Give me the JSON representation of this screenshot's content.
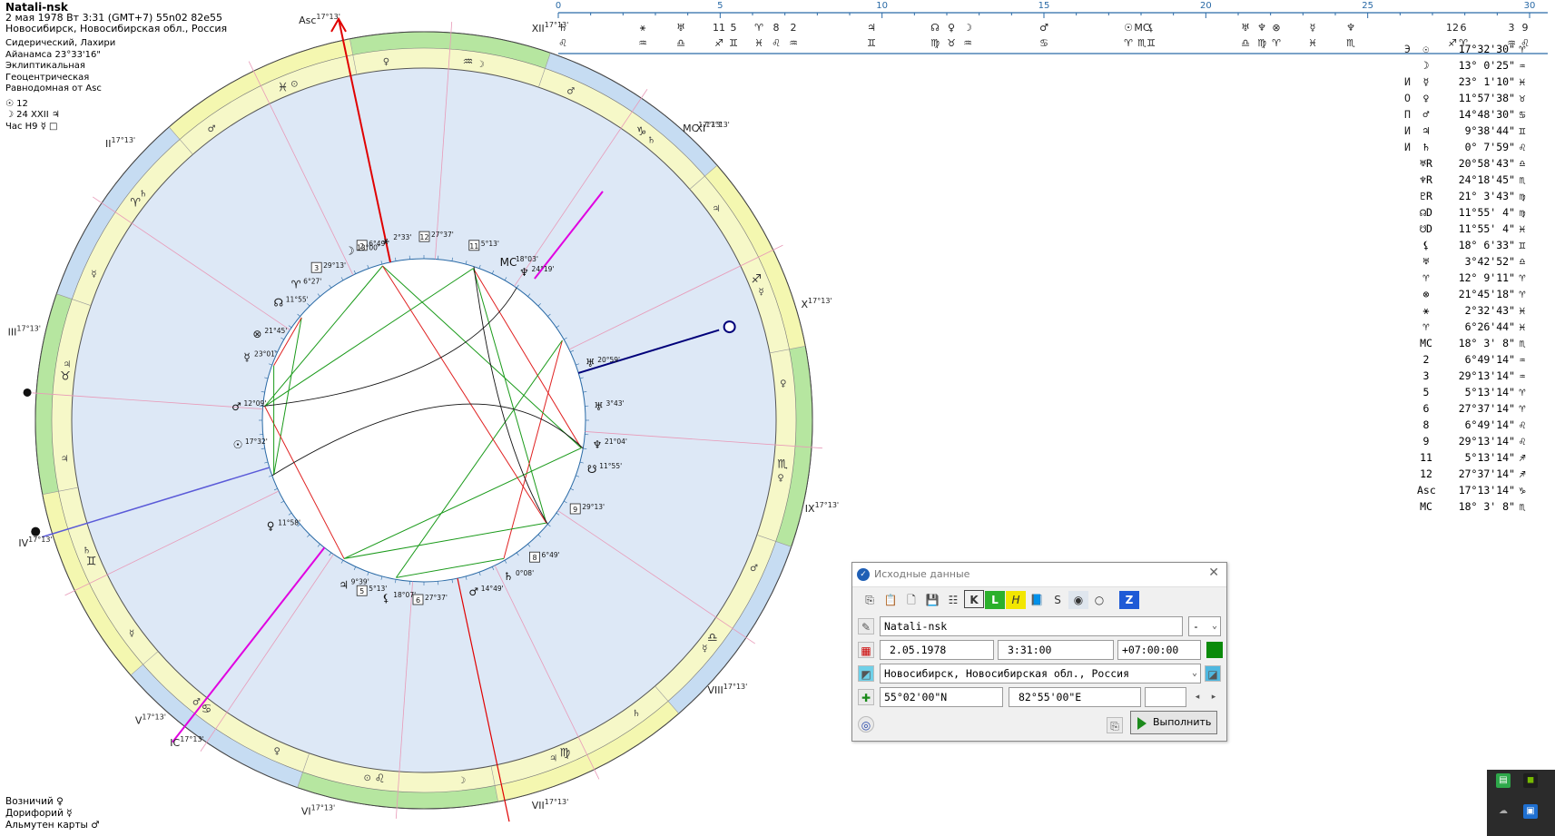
{
  "chart": {
    "name": "Natali-nsk",
    "datetime": "2 мая 1978  Вт   3:31 (GMT+7) 55n02  82e55",
    "place": "Новосибирск, Новосибирская обл., Россия",
    "settings": [
      "Сидерический, Лахири",
      "Айанамса 23°33'16\"",
      "Эклиптикальная",
      "Геоцентрическая",
      "Равнодомная от Asc"
    ],
    "extra": [
      "☉  12",
      "☽  24 XXII ♃",
      "Час Н9 ☿ □"
    ]
  },
  "bottom_left": [
    "Возничий  ♀",
    "Дорифорий  ☿",
    "Альмутен карты  ♂"
  ],
  "wheel": {
    "houses": [
      {
        "num": "XII",
        "deg": "17°13'"
      },
      {
        "num": "XI",
        "deg": "17°13'"
      },
      {
        "num": "X",
        "deg": "17°13'"
      },
      {
        "num": "IX",
        "deg": "17°13'"
      },
      {
        "num": "VIII",
        "deg": "17°13'"
      },
      {
        "num": "VII",
        "deg": "17°13'"
      },
      {
        "num": "VI",
        "deg": "17°13'"
      },
      {
        "num": "V",
        "deg": "17°13'"
      },
      {
        "num": "IV",
        "deg": "17°13'"
      },
      {
        "num": "III",
        "deg": "17°13'"
      },
      {
        "num": "II",
        "deg": "17°13'"
      }
    ],
    "asc_label": "Asc",
    "asc_deg": "17°13'",
    "mc_label": "MC",
    "mc_deg": "17°13'",
    "ic_label": "IC",
    "ic_deg": "17°13'",
    "signs": [
      "♉",
      "♊",
      "♋",
      "♌",
      "♍",
      "♎",
      "♏",
      "♐",
      "♑",
      "♒",
      "♓",
      "♈"
    ],
    "inner_labels": [
      {
        "t": "12",
        "box": true,
        "d": "27°37'"
      },
      {
        "t": "11",
        "box": true,
        "d": "5°13'"
      },
      {
        "t": "2",
        "box": true,
        "d": "6°49'"
      },
      {
        "t": "⚹",
        "box": false,
        "d": "2°33'"
      },
      {
        "t": "☽",
        "box": false,
        "d": "13°00'"
      },
      {
        "t": "3",
        "box": true,
        "d": "29°13'"
      },
      {
        "t": "♈",
        "box": false,
        "d": "6°27'"
      },
      {
        "t": "☊",
        "box": false,
        "d": "11°55'"
      },
      {
        "t": "⊗",
        "box": false,
        "d": "21°45'"
      },
      {
        "t": "☿",
        "box": false,
        "d": "23°01'"
      },
      {
        "t": "♂",
        "box": false,
        "d": "12°09'"
      },
      {
        "t": "☉",
        "box": false,
        "d": "17°32'"
      },
      {
        "t": "♀",
        "box": false,
        "d": "11°58'"
      },
      {
        "t": "♃",
        "box": false,
        "d": "9°39'"
      },
      {
        "t": "5",
        "box": true,
        "d": "5°13'"
      },
      {
        "t": "⚸",
        "box": false,
        "d": "18°07'"
      },
      {
        "t": "6",
        "box": true,
        "d": "27°37'"
      },
      {
        "t": "♂",
        "box": false,
        "d": "14°49'"
      },
      {
        "t": "♄",
        "box": false,
        "d": "0°08'"
      },
      {
        "t": "8",
        "box": true,
        "d": "6°49'"
      },
      {
        "t": "9",
        "box": true,
        "d": "29°13'"
      },
      {
        "t": "☋",
        "box": false,
        "d": "11°55'"
      },
      {
        "t": "♆",
        "box": false,
        "d": "21°04'"
      },
      {
        "t": "♅",
        "box": false,
        "d": "3°43'"
      },
      {
        "t": "♅",
        "box": false,
        "d": "20°59'"
      },
      {
        "t": "♆",
        "box": false,
        "d": "24°19'"
      },
      {
        "t": "MC",
        "box": false,
        "d": "18°03'"
      }
    ]
  },
  "timeline": {
    "ticks": [
      "0",
      "5",
      "10",
      "15",
      "20",
      "25",
      "30"
    ]
  },
  "positions": [
    {
      "p": "Э",
      "g": "☉",
      "v": "17°32'30\"",
      "s": "♈"
    },
    {
      "p": "",
      "g": "☽",
      "v": "13° 0'25\"",
      "s": "♒"
    },
    {
      "p": "И",
      "g": "☿",
      "v": "23° 1'10\"",
      "s": "♓"
    },
    {
      "p": "О",
      "g": "♀",
      "v": "11°57'38\"",
      "s": "♉"
    },
    {
      "p": "П",
      "g": "♂",
      "v": "14°48'30\"",
      "s": "♋"
    },
    {
      "p": "И",
      "g": "♃",
      "v": "9°38'44\"",
      "s": "♊"
    },
    {
      "p": "И",
      "g": "♄",
      "v": "0° 7'59\"",
      "s": "♌"
    },
    {
      "p": "",
      "g": "♅R",
      "v": "20°58'43\"",
      "s": "♎"
    },
    {
      "p": "",
      "g": "♆R",
      "v": "24°18'45\"",
      "s": "♏"
    },
    {
      "p": "",
      "g": "♇R",
      "v": "21° 3'43\"",
      "s": "♍"
    },
    {
      "p": "",
      "g": "☊D",
      "v": "11°55' 4\"",
      "s": "♍"
    },
    {
      "p": "",
      "g": "☋D",
      "v": "11°55' 4\"",
      "s": "♓"
    },
    {
      "p": "",
      "g": "⚸",
      "v": "18° 6'33\"",
      "s": "♊"
    },
    {
      "p": "",
      "g": "♅",
      "v": "3°42'52\"",
      "s": "♎"
    },
    {
      "p": "",
      "g": "♈",
      "v": "12° 9'11\"",
      "s": "♈"
    },
    {
      "p": "",
      "g": "⊗",
      "v": "21°45'18\"",
      "s": "♈"
    },
    {
      "p": "",
      "g": "⚹",
      "v": "2°32'43\"",
      "s": "♓"
    },
    {
      "p": "",
      "g": "♈",
      "v": "6°26'44\"",
      "s": "♓"
    },
    {
      "p": "",
      "g": "MC",
      "v": "18° 3' 8\"",
      "s": "♏"
    },
    {
      "p": "",
      "g": "2",
      "v": "6°49'14\"",
      "s": "♒"
    },
    {
      "p": "",
      "g": "3",
      "v": "29°13'14\"",
      "s": "♒"
    },
    {
      "p": "",
      "g": "5",
      "v": "5°13'14\"",
      "s": "♈"
    },
    {
      "p": "",
      "g": "6",
      "v": "27°37'14\"",
      "s": "♈"
    },
    {
      "p": "",
      "g": "8",
      "v": "6°49'14\"",
      "s": "♌"
    },
    {
      "p": "",
      "g": "9",
      "v": "29°13'14\"",
      "s": "♌"
    },
    {
      "p": "",
      "g": "11",
      "v": "5°13'14\"",
      "s": "♐"
    },
    {
      "p": "",
      "g": "12",
      "v": "27°37'14\"",
      "s": "♐"
    },
    {
      "p": "",
      "g": "Asc",
      "v": "17°13'14\"",
      "s": "♑"
    },
    {
      "p": "",
      "g": "MC",
      "v": "18° 3' 8\"",
      "s": "♏"
    }
  ],
  "dialog": {
    "title": "Исходные данные",
    "name_value": "Natali-nsk",
    "name_select": "-",
    "date": "2.05.1978",
    "time": "3:31:00",
    "tz": "+07:00:00",
    "place": "Новосибирск, Новосибирская обл., Россия",
    "lat": "55°02'00\"N",
    "lon": "82°55'00\"E",
    "run_label": "Выполнить",
    "toolbar_icons": [
      "copy-icon",
      "paste-icon",
      "new-icon",
      "save-icon",
      "table-icon",
      "k-icon",
      "l-icon",
      "h-icon",
      "book-icon",
      "s-icon",
      "dot-circle-icon",
      "circle-icon",
      "z-icon"
    ],
    "toolbar_glyphs": [
      "⎘",
      "📋",
      "🗋",
      "💾",
      "☷",
      "K",
      "L",
      "H",
      "📘",
      "S",
      "◉",
      "○",
      "Z"
    ]
  },
  "colors": {
    "wheel_bg": "#dde8f6",
    "green_band": "#b6e6a0",
    "yellow_band": "#f4f7b0",
    "blue_band": "#c6dcf2",
    "asc_line": "#e00000",
    "mc_line": "#e000e0",
    "desc_line": "#00007a"
  }
}
